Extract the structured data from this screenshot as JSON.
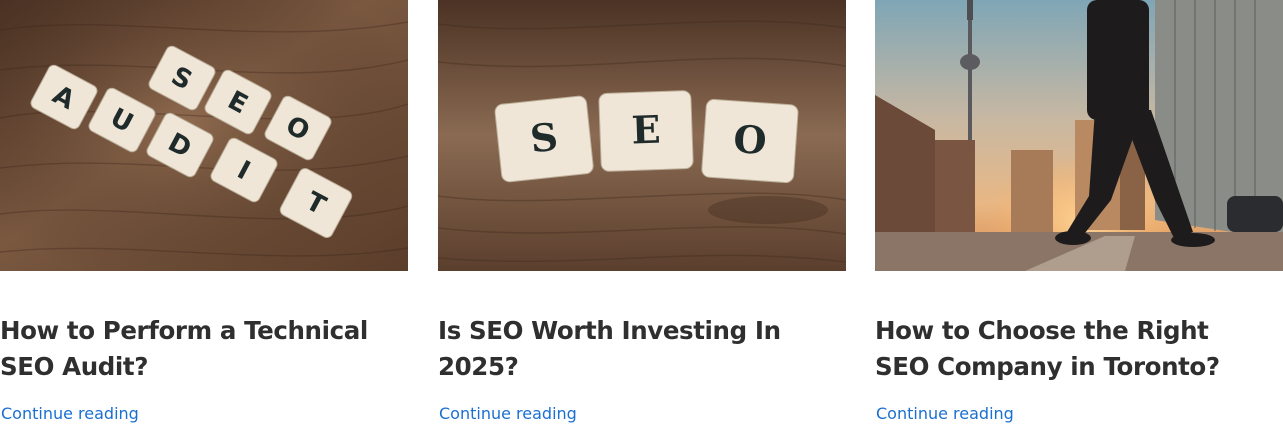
{
  "posts": [
    {
      "image": "scrabble-tiles-spelling-seo-audit-on-wood",
      "title_lines": [
        "How to Perform a Technical",
        "SEO Audit?"
      ],
      "link_label": "Continue reading"
    },
    {
      "image": "scrabble-tiles-spelling-seo-on-wood",
      "title_lines": [
        "Is SEO Worth Investing In",
        "2025?"
      ],
      "link_label": "Continue reading"
    },
    {
      "image": "businessman-walking-toronto-street-cn-tower-sunset",
      "title_lines": [
        "How to Choose the Right",
        "SEO Company in Toronto?"
      ],
      "link_label": "Continue reading"
    }
  ],
  "colors": {
    "title": "#2f2f2f",
    "link": "#1a6fd1",
    "wood": "#6b4a33",
    "tile": "#efe6d8"
  }
}
